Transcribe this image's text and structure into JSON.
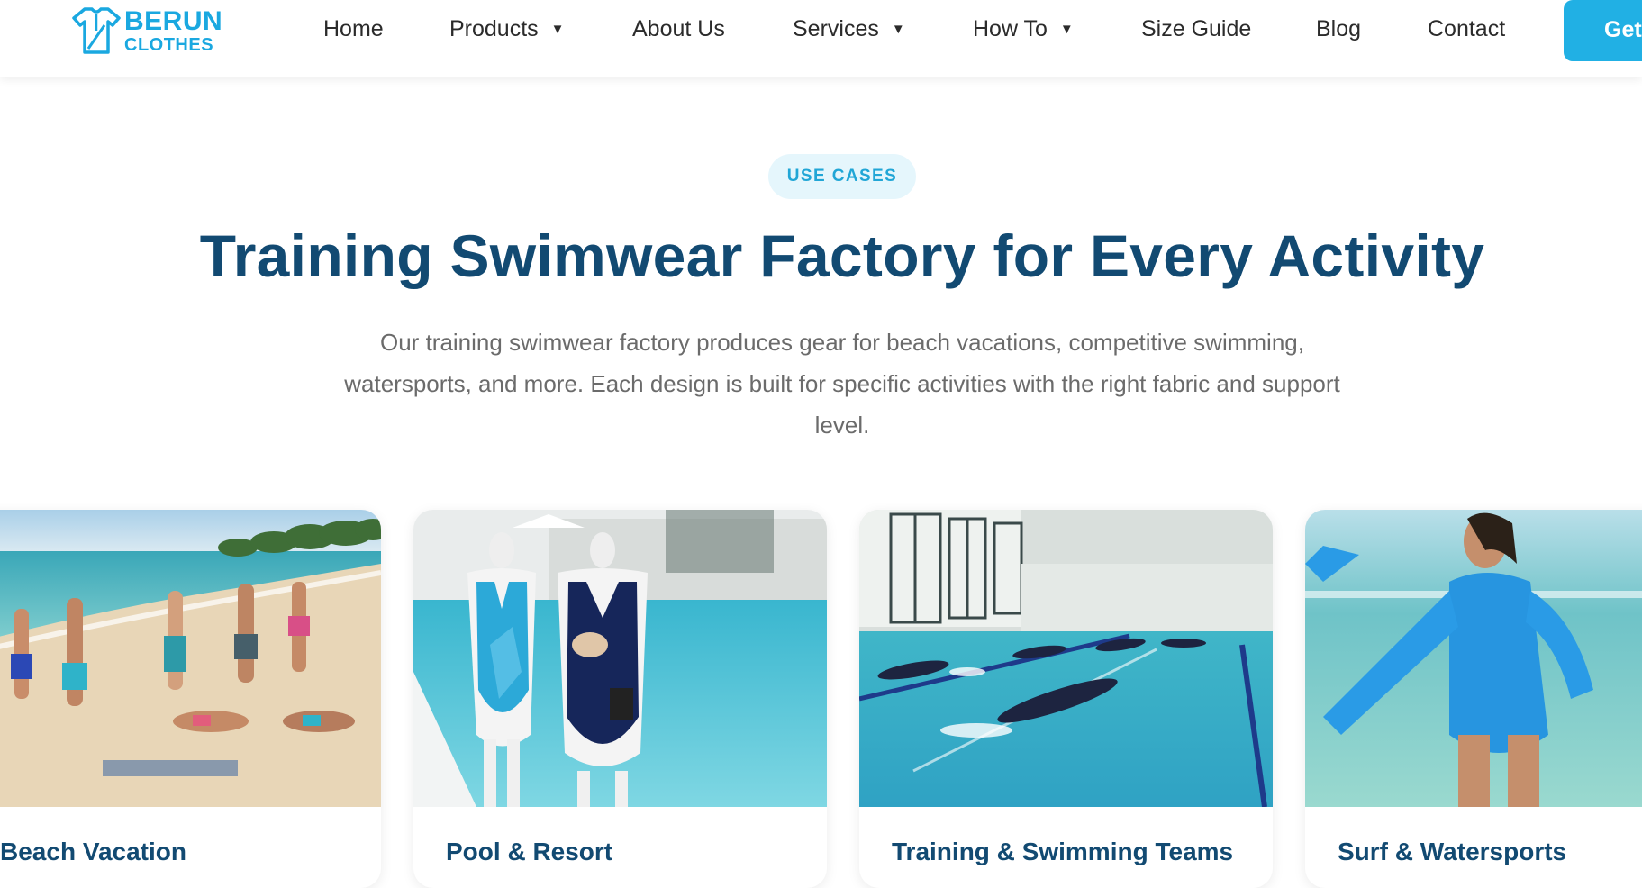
{
  "brand": {
    "line1": "BERUN",
    "line2": "CLOTHES"
  },
  "nav": {
    "items": [
      {
        "label": "Home",
        "dropdown": false
      },
      {
        "label": "Products",
        "dropdown": true
      },
      {
        "label": "About Us",
        "dropdown": false
      },
      {
        "label": "Services",
        "dropdown": true
      },
      {
        "label": "How To",
        "dropdown": true
      },
      {
        "label": "Size Guide",
        "dropdown": false
      },
      {
        "label": "Blog",
        "dropdown": false
      },
      {
        "label": "Contact",
        "dropdown": false
      }
    ],
    "caret": "▼",
    "cta_label": "Get"
  },
  "hero": {
    "badge": "USE CASES",
    "title": "Training Swimwear Factory for Every Activity",
    "description": "Our training swimwear factory produces gear for beach vacations, competitive swimming, watersports, and more. Each design is built for specific activities with the right fabric and support level."
  },
  "cards": [
    {
      "title": "Beach Vacation",
      "image": "beach-group-photo"
    },
    {
      "title": "Pool & Resort",
      "image": "mannequin-swimsuits-photo"
    },
    {
      "title": "Training & Swimming Teams",
      "image": "indoor-pool-swimmers-photo"
    },
    {
      "title": "Surf & Watersports",
      "image": "rashguard-surfer-photo"
    }
  ],
  "colors": {
    "brand_blue": "#1aa8e0",
    "heading_navy": "#124a72",
    "cta_blue": "#21b0e4",
    "badge_bg": "#e5f6fc"
  }
}
